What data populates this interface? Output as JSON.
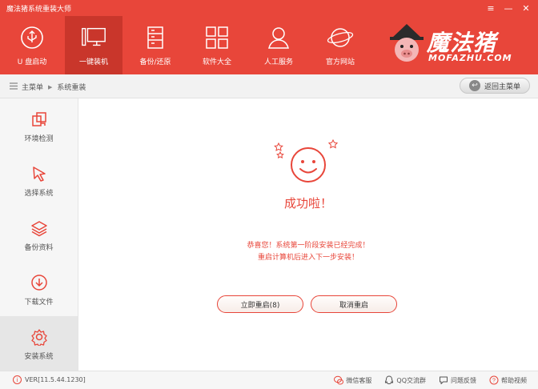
{
  "app": {
    "title": "魔法猪系统重装大师",
    "accent_color": "#e8463a"
  },
  "window_controls": [
    {
      "name": "menu-icon",
      "glyph": "≡"
    },
    {
      "name": "minimize-icon",
      "glyph": "—"
    },
    {
      "name": "close-icon",
      "glyph": "✕"
    }
  ],
  "nav": {
    "items": [
      {
        "label": "U 盘启动",
        "icon": "usb-icon"
      },
      {
        "label": "一键装机",
        "icon": "monitor-icon",
        "active": true
      },
      {
        "label": "备份/还原",
        "icon": "backup-icon"
      },
      {
        "label": "软件大全",
        "icon": "grid-icon"
      },
      {
        "label": "人工服务",
        "icon": "person-icon"
      },
      {
        "label": "官方网站",
        "icon": "globe-icon"
      }
    ]
  },
  "brand": {
    "name_cn": "魔法猪",
    "name_en": "MOFAZHU.COM"
  },
  "breadcrumb": {
    "root": "主菜单",
    "current": "系统重装"
  },
  "back_button": {
    "label": "返回主菜单"
  },
  "sidebar": {
    "items": [
      {
        "label": "环境检测",
        "icon": "environment-check-icon"
      },
      {
        "label": "选择系统",
        "icon": "cursor-icon"
      },
      {
        "label": "备份资料",
        "icon": "layers-icon"
      },
      {
        "label": "下载文件",
        "icon": "download-icon"
      },
      {
        "label": "安装系统",
        "icon": "gear-icon",
        "active": true
      }
    ]
  },
  "main": {
    "success_text": "成功啦！",
    "message_line1": "恭喜您！系统第一阶段安装已经完成！",
    "message_line2": "重启计算机后进入下一步安装！",
    "restart_button": "立即重启(8)",
    "cancel_button": "取消重启"
  },
  "status": {
    "version": "VER[11.5.44.1230]",
    "links": [
      {
        "label": "微信客服",
        "icon": "wechat-icon"
      },
      {
        "label": "QQ交流群",
        "icon": "qq-icon"
      },
      {
        "label": "问题反馈",
        "icon": "feedback-icon"
      },
      {
        "label": "帮助视频",
        "icon": "help-icon"
      }
    ]
  }
}
